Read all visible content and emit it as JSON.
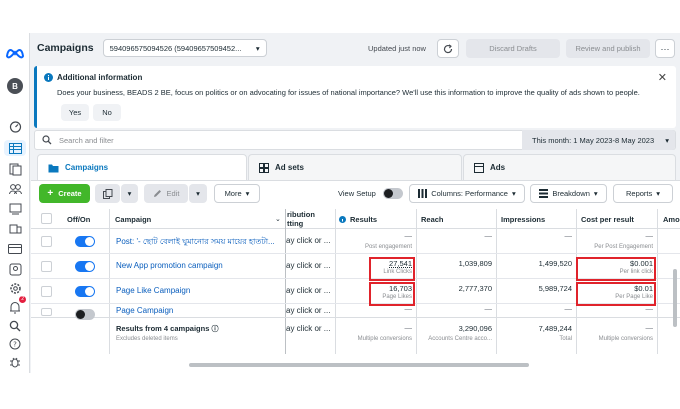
{
  "colors": {
    "accent": "#0a78be",
    "create": "#42b72a",
    "highlight": "#e0232b",
    "toggle_on": "#1877f2"
  },
  "rail": {
    "avatar_letter": "B",
    "icons": [
      "meta-logo-icon",
      "dashboard-icon",
      "campaigns-table-icon",
      "pages-icon",
      "accounts-icon",
      "ads-manager-icon",
      "catalog-icon",
      "billing-icon",
      "audience-icon",
      "settings-icon",
      "notifications-icon",
      "search-icon",
      "help-icon",
      "bug-icon"
    ],
    "notif_count": "2"
  },
  "topbar": {
    "title": "Campaigns",
    "account": "594096575094526 (59409657509452...",
    "updated": "Updated just now",
    "discard": "Discard Drafts",
    "publish": "Review and publish",
    "more": "···"
  },
  "banner": {
    "title": "Additional information",
    "text": "Does your business, BEADS 2 BE, focus on politics or on advocating for issues of national importance? We'll use this information to improve the quality of ads shown to people.",
    "yes": "Yes",
    "no": "No"
  },
  "search": {
    "placeholder": "Search and filter",
    "date_range": "This month: 1 May 2023-8 May 2023"
  },
  "tabs": {
    "campaigns": "Campaigns",
    "adsets": "Ad sets",
    "ads": "Ads"
  },
  "toolbar": {
    "create": "Create",
    "edit": "Edit",
    "more": "More",
    "view_setup": "View Setup",
    "columns": "Columns: Performance",
    "breakdown": "Breakdown",
    "reports": "Reports"
  },
  "table": {
    "headers": {
      "onoff": "Off/On",
      "campaign": "Campaign",
      "attribution": "ribution\ntting",
      "results": "Results",
      "reach": "Reach",
      "impressions": "Impressions",
      "cpr": "Cost per result",
      "amount": "Amo"
    },
    "rows": [
      {
        "name": "Post: '- ছোট বেলাই ঘুমানোর সময় মায়ের হাতটা...",
        "on": true,
        "attribution": "ay click or ...",
        "results": "—",
        "results_sub": "Post engagement",
        "reach": "—",
        "impressions": "—",
        "cpr": "—",
        "cpr_sub": "Per Post Engagement"
      },
      {
        "name": "New App promotion campaign",
        "on": true,
        "attribution": "ay click or ...",
        "results": "27,541",
        "results_sub": "Link Clicks",
        "reach": "1,039,809",
        "impressions": "1,499,520",
        "cpr": "$0.001",
        "cpr_sub": "Per link click"
      },
      {
        "name": "Page Like Campaign",
        "on": true,
        "attribution": "ay click or ...",
        "results": "16,703",
        "results_sub": "Page Likes",
        "reach": "2,777,370",
        "impressions": "5,989,724",
        "cpr": "$0.01",
        "cpr_sub": "Per Page Like"
      },
      {
        "name": "Page Campaign",
        "on": false,
        "attribution": "ay click or ...",
        "results": "—",
        "results_sub": "",
        "reach": "—",
        "impressions": "—",
        "cpr": "—",
        "cpr_sub": ""
      }
    ],
    "summary": {
      "title": "Results from 4 campaigns",
      "sub": "Excludes deleted items",
      "attribution": "ay click or ...",
      "results": "—",
      "results_sub": "Multiple conversions",
      "reach": "3,290,096",
      "reach_sub": "Accounts Centre acco...",
      "impressions": "7,489,244",
      "impressions_sub": "Total",
      "cpr": "—",
      "cpr_sub": "Multiple conversions"
    }
  }
}
